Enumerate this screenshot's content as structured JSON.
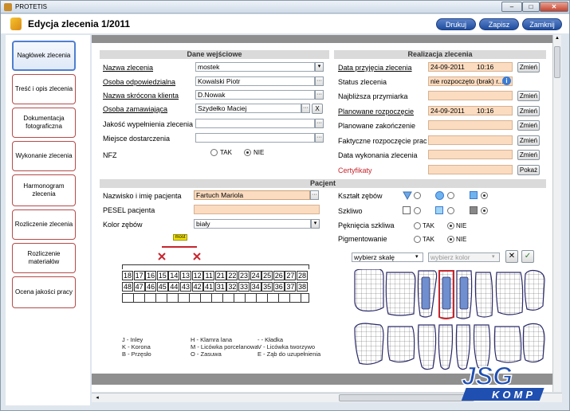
{
  "window": {
    "app_title": "PROTETIS",
    "min": "–",
    "max": "□",
    "close": "✕"
  },
  "header": {
    "title": "Edycja zlecenia 1/2011",
    "print": "Drukuj",
    "save": "Zapisz",
    "close": "Zamknij"
  },
  "sidebar": {
    "items": [
      {
        "label": "Nagłówek zlecenia"
      },
      {
        "label": "Treść i opis zlecenia"
      },
      {
        "label": "Dokumentacja fotograficzna"
      },
      {
        "label": "Wykonanie zlecenia"
      },
      {
        "label": "Harmonogram zlecenia"
      },
      {
        "label": "Rozliczenie zlecenia"
      },
      {
        "label": "Rozliczenie materiałów"
      },
      {
        "label": "Ocena jakości pracy"
      }
    ]
  },
  "input": {
    "header": "Dane wejściowe",
    "order_name_label": "Nazwa zlecenia",
    "order_name": "mostek",
    "responsible_label": "Osoba odpowiedzialna",
    "responsible": "Kowalski Piotr",
    "client_short_label": "Nazwa skrócona klienta",
    "client_short": "D.Nowak",
    "ordering_label": "Osoba zamawiająca",
    "ordering": "Szydełko Maciej",
    "quality_label": "Jakość wypełnienia zlecenia",
    "quality": "",
    "delivery_label": "Miejsce dostarczenia",
    "delivery": "",
    "nfz_label": "NFZ",
    "yes": "TAK",
    "no": "NIE",
    "clear": "X"
  },
  "realization": {
    "header": "Realizacja zlecenia",
    "received_label": "Data przyjęcia zlecenia",
    "received_date": "24-09-2011",
    "received_time": "10:16",
    "status_label": "Status zlecenia",
    "status": "nie rozpoczęto (brak) r...",
    "next_fitting_label": "Najbliższa przymiarka",
    "planned_start_label": "Planowane rozpoczęcie",
    "planned_start_date": "24-09-2011",
    "planned_start_time": "10:16",
    "planned_end_label": "Planowane zakończenie",
    "actual_start_label": "Faktyczne rozpoczęcie prac",
    "done_label": "Data wykonania zlecenia",
    "certificates_label": "Certyfikaty",
    "change": "Zmień",
    "show": "Pokaż",
    "info": "i"
  },
  "patient": {
    "header": "Pacjent",
    "name_label": "Nazwisko i imię pacjenta",
    "name": "Fartuch Mariola",
    "pesel_label": "PESEL pacjenta",
    "pesel": "",
    "color_label": "Kolor zębów",
    "color": "biały",
    "shape_label": "Kształt zębów",
    "glass_label": "Szkliwo",
    "crack_label": "Pęknięcia szkliwa",
    "pigment_label": "Pigmentowanie",
    "yes": "TAK",
    "no": "NIE",
    "scale_select": "wybierz skalę",
    "color_select": "wybierz kolor",
    "bridge_tag": "most"
  },
  "teeth": {
    "upper": [
      "18",
      "17",
      "16",
      "15",
      "14",
      "13",
      "12",
      "11",
      "21",
      "22",
      "23",
      "24",
      "25",
      "26",
      "27",
      "28"
    ],
    "lower": [
      "48",
      "47",
      "46",
      "45",
      "44",
      "43",
      "42",
      "41",
      "31",
      "32",
      "33",
      "34",
      "35",
      "36",
      "37",
      "38"
    ]
  },
  "legend": {
    "c1": [
      "J - Inley",
      "K - Korona",
      "B - Przęsło"
    ],
    "c2": [
      "H - Klamra lana",
      "M - Licówka porcelanowa",
      "O - Zasuwa"
    ],
    "c3": [
      "- - Kładka",
      "V - Licówka tworzywo",
      "E - Ząb do uzupełnienia"
    ]
  },
  "brand": {
    "text": "JSG",
    "sub": "KOMP"
  },
  "colors": {
    "accent": "#2f5fb0",
    "peach": "#fbdcc0",
    "nav_border": "#b64a4a",
    "selected_tooth": "#c6262e"
  }
}
